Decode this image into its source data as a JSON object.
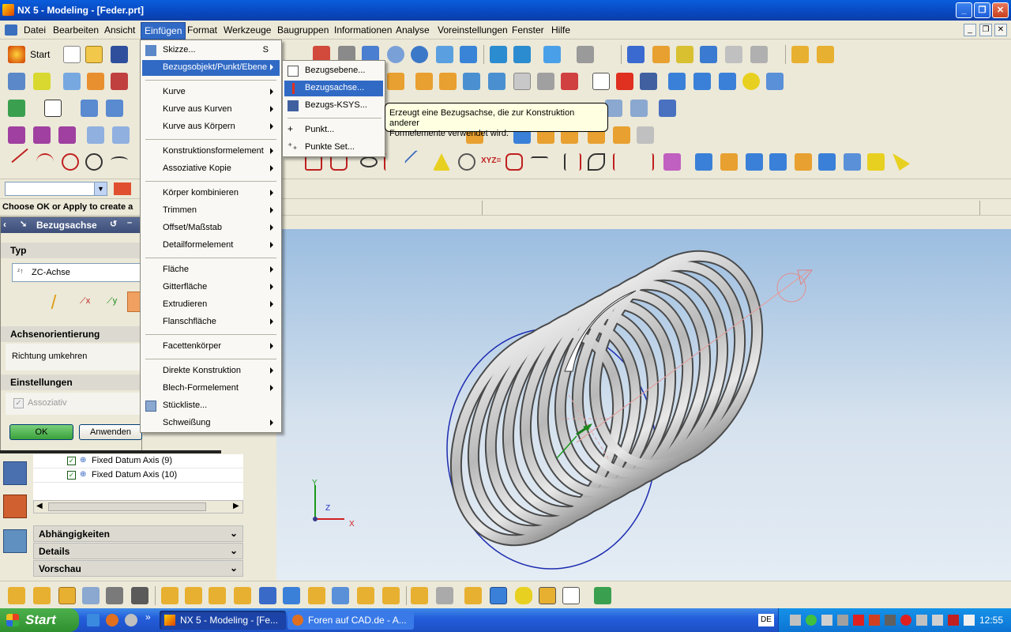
{
  "window": {
    "title": "NX 5 - Modeling - [Feder.prt]"
  },
  "menubar": [
    "Datei",
    "Bearbeiten",
    "Ansicht",
    "Einfügen",
    "Format",
    "Werkzeuge",
    "Baugruppen",
    "Informationen",
    "Analyse",
    "Voreinstellungen",
    "Fenster",
    "Hilfe"
  ],
  "toolbar": {
    "start_label": "Start"
  },
  "statusline": {
    "prompt": "Choose OK or Apply to create a"
  },
  "dialog": {
    "title": "Bezugsachse",
    "section_type": "Typ",
    "type_value": "ZC-Achse",
    "section_axis": "Achsenorientierung",
    "reverse_direction": "Richtung umkehren",
    "section_settings": "Einstellungen",
    "associative": "Assoziativ",
    "ok": "OK",
    "apply": "Anwenden"
  },
  "insert_menu": {
    "items": [
      {
        "label": "Skizze...",
        "shortcut": "S"
      },
      {
        "label": "Bezugsobjekt/Punkt/Ebene"
      },
      {
        "label": "Kurve"
      },
      {
        "label": "Kurve aus Kurven"
      },
      {
        "label": "Kurve aus Körpern"
      },
      {
        "label": "Konstruktionsformelement"
      },
      {
        "label": "Assoziative Kopie"
      },
      {
        "label": "Körper kombinieren"
      },
      {
        "label": "Trimmen"
      },
      {
        "label": "Offset/Maßstab"
      },
      {
        "label": "Detailformelement"
      },
      {
        "label": "Fläche"
      },
      {
        "label": "Gitterfläche"
      },
      {
        "label": "Extrudieren"
      },
      {
        "label": "Flanschfläche"
      },
      {
        "label": "Facettenkörper"
      },
      {
        "label": "Direkte Konstruktion"
      },
      {
        "label": "Blech-Formelement"
      },
      {
        "label": "Stückliste..."
      },
      {
        "label": "Schweißung"
      }
    ]
  },
  "submenu": {
    "items": [
      "Bezugsebene...",
      "Bezugsachse...",
      "Bezugs-KSYS...",
      "Punkt...",
      "Punkte Set..."
    ]
  },
  "tooltip": {
    "line1": "Erzeugt eine Bezugsachse, die zur Konstruktion anderer",
    "line2": "Formelemente verwendet wird."
  },
  "navigator": {
    "rows": [
      "Fixed Datum Axis (9)",
      "Fixed Datum Axis (10)"
    ],
    "sections": [
      "Abhängigkeiten",
      "Details",
      "Vorschau"
    ]
  },
  "viewport": {
    "triad": {
      "y": "Y",
      "z": "Z",
      "x": "X"
    }
  },
  "taskbar": {
    "start": "Start",
    "tasks": [
      "NX 5 - Modeling - [Fe...",
      "Foren auf CAD.de - A..."
    ],
    "lang": "DE",
    "clock": "12:55"
  }
}
